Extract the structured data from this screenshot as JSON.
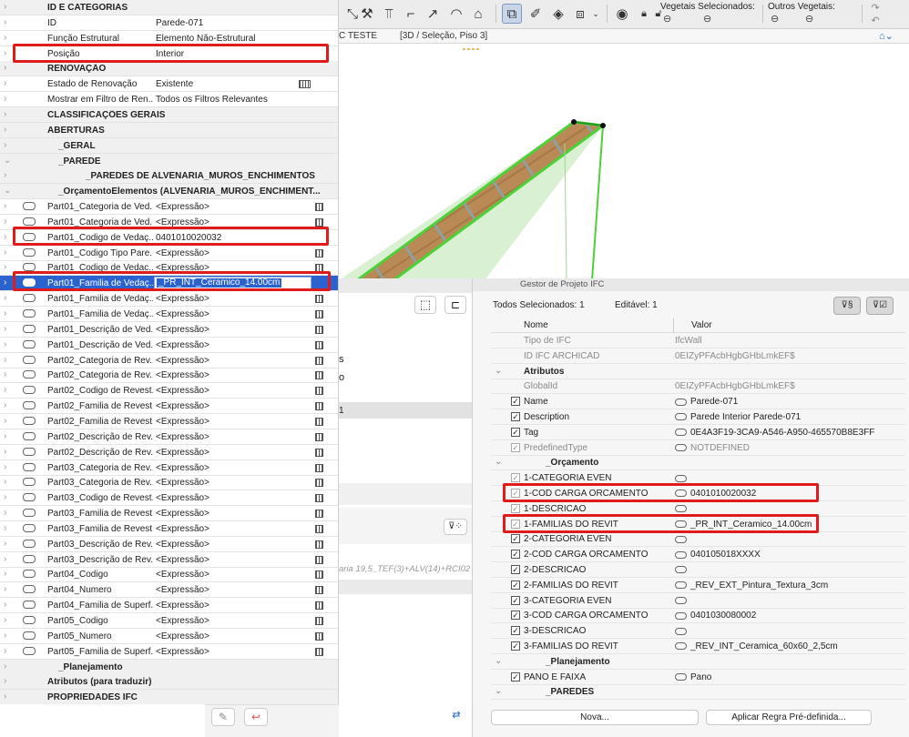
{
  "toolbar": {
    "vegetais_label": "Vegetais Selecionados:",
    "outros_label": "Outros Vegetais:"
  },
  "tabs": {
    "tab1": "C TESTE",
    "tab2": "[3D / Seleção, Piso 3]"
  },
  "left_panel": {
    "rows": [
      {
        "type": "header",
        "label": "ID E CATEGORIAS"
      },
      {
        "type": "prop",
        "label": "ID",
        "value": "Parede-071"
      },
      {
        "type": "prop",
        "label": "Função Estrutural",
        "value": "Elemento Não-Estrutural"
      },
      {
        "type": "prop",
        "label": "Posição",
        "value": "Interior"
      },
      {
        "type": "header",
        "label": "RENOVAÇÃO"
      },
      {
        "type": "prop",
        "label": "Estado de Renovação",
        "value": "Existente",
        "icon": "grid-icon"
      },
      {
        "type": "prop",
        "label": "Mostrar em Filtro de Ren...",
        "value": "Todos os Filtros Relevantes"
      },
      {
        "type": "header",
        "chev": "›",
        "label": "CLASSIFICAÇÕES GERAIS"
      },
      {
        "type": "header",
        "chev": "›",
        "label": "ABERTURAS"
      },
      {
        "type": "header",
        "chev": "›",
        "label": "_GERAL",
        "indent": 1
      },
      {
        "type": "header",
        "chev": "⌄",
        "label": "_PAREDE",
        "indent": 1
      },
      {
        "type": "header",
        "chev": "›",
        "label": "_PAREDES DE ALVENARIA_MUROS_ENCHIMENTOS",
        "indent": 2
      },
      {
        "type": "header",
        "chev": "⌄",
        "label": "_OrçamentoElementos (ALVENARIA_MUROS_ENCHIMENT...",
        "indent": 1
      },
      {
        "type": "exp",
        "label": "Part01_Categoria de Ved...",
        "value": "<Expressão>"
      },
      {
        "type": "exp",
        "label": "Part01_Categoria de Ved...",
        "value": "<Expressão>"
      },
      {
        "type": "exp",
        "label": "Part01_Codigo de Vedaç...",
        "value": "0401010020032",
        "nocalc": true
      },
      {
        "type": "exp",
        "label": "Part01_Codigo Tipo Pare...",
        "value": "<Expressão>"
      },
      {
        "type": "exp",
        "label": "Part01_Codigo de Vedac...",
        "value": "<Expressão>"
      },
      {
        "type": "selected",
        "label": "Part01_Familia de Vedaç...",
        "value": "_PR_INT_Ceramico_14.00cm"
      },
      {
        "type": "exp",
        "label": "Part01_Familia de Vedaç...",
        "value": "<Expressão>"
      },
      {
        "type": "exp",
        "label": "Part01_Familia de Vedaç...",
        "value": "<Expressão>"
      },
      {
        "type": "exp",
        "label": "Part01_Descrição de Ved...",
        "value": "<Expressão>"
      },
      {
        "type": "exp",
        "label": "Part01_Descrição de Ved...",
        "value": "<Expressão>"
      },
      {
        "type": "exp",
        "label": "Part02_Categoria de Rev...",
        "value": "<Expressão>"
      },
      {
        "type": "exp",
        "label": "Part02_Categoria de Rev...",
        "value": "<Expressão>"
      },
      {
        "type": "exp",
        "label": "Part02_Codigo de Revest...",
        "value": "<Expressão>"
      },
      {
        "type": "exp",
        "label": "Part02_Familia de Revest...",
        "value": "<Expressão>"
      },
      {
        "type": "exp",
        "label": "Part02_Familia de Revest...",
        "value": "<Expressão>"
      },
      {
        "type": "exp",
        "label": "Part02_Descrição de Rev...",
        "value": "<Expressão>"
      },
      {
        "type": "exp",
        "label": "Part02_Descrição de Rev...",
        "value": "<Expressão>"
      },
      {
        "type": "exp",
        "label": "Part03_Categoria de Rev...",
        "value": "<Expressão>"
      },
      {
        "type": "exp",
        "label": "Part03_Categoria de Rev...",
        "value": "<Expressão>"
      },
      {
        "type": "exp",
        "label": "Part03_Codigo de Revest...",
        "value": "<Expressão>"
      },
      {
        "type": "exp",
        "label": "Part03_Familia de Revest...",
        "value": "<Expressão>"
      },
      {
        "type": "exp",
        "label": "Part03_Familia de Revest...",
        "value": "<Expressão>"
      },
      {
        "type": "exp",
        "label": "Part03_Descrição de Rev...",
        "value": "<Expressão>"
      },
      {
        "type": "exp",
        "label": "Part03_Descrição de Rev...",
        "value": "<Expressão>"
      },
      {
        "type": "exp",
        "label": "Part04_Codigo",
        "value": "<Expressão>"
      },
      {
        "type": "exp",
        "label": "Part04_Numero",
        "value": "<Expressão>"
      },
      {
        "type": "exp",
        "label": "Part04_Familia de Superf...",
        "value": "<Expressão>"
      },
      {
        "type": "exp",
        "label": "Part05_Codigo",
        "value": "<Expressão>"
      },
      {
        "type": "exp",
        "label": "Part05_Numero",
        "value": "<Expressão>"
      },
      {
        "type": "exp",
        "label": "Part05_Familia de Superf...",
        "value": "<Expressão>"
      },
      {
        "type": "header",
        "chev": "›",
        "label": "_Planejamento",
        "indent": 1
      },
      {
        "type": "header",
        "chev": "›",
        "label": "Atributos (para traduzir)"
      },
      {
        "type": "header",
        "chev": "›",
        "label": "PROPRIEDADES IFC"
      }
    ]
  },
  "mid_panel": {
    "fragments": [
      "s",
      "o",
      "1",
      "aria 19,5_TEF(3)+ALV(14)+RCI02"
    ]
  },
  "ifc": {
    "title": "Gestor de Projeto IFC",
    "all_selected": "Todos Selecionados: 1",
    "editable": "Editável: 1",
    "col_name": "Nome",
    "col_value": "Valor",
    "rows": [
      {
        "kind": "plain",
        "name": "Tipo de IFC",
        "value": "IfcWall",
        "gray": true
      },
      {
        "kind": "plain",
        "name": "ID IFC ARCHICAD",
        "value": "0EIZyPFAcbHgbGHbLmkEF$",
        "gray": true
      },
      {
        "kind": "group",
        "name": "Atributos"
      },
      {
        "kind": "plain",
        "name": "GlobalId",
        "value": "0EIZyPFAcbHgbGHbLmkEF$",
        "gray": true
      },
      {
        "kind": "check",
        "name": "Name",
        "value": "Parede-071",
        "link": true
      },
      {
        "kind": "check",
        "name": "Description",
        "value": "Parede Interior Parede-071",
        "link": true
      },
      {
        "kind": "check",
        "name": "Tag",
        "value": "0E4A3F19-3CA9-A546-A950-465570B8E3FF",
        "link": true
      },
      {
        "kind": "check",
        "name": "PredefinedType",
        "value": "NOTDEFINED",
        "link": true,
        "gray": true
      },
      {
        "kind": "group",
        "name": "_Orçamento",
        "indent": true
      },
      {
        "kind": "check",
        "name": "1-CATEGORIA EVEN",
        "value": "",
        "link": true,
        "dim": true
      },
      {
        "kind": "check",
        "name": "1-COD CARGA ORCAMENTO",
        "value": "0401010020032",
        "link": true,
        "dim": true
      },
      {
        "kind": "check",
        "name": "1-DESCRICAO",
        "value": "",
        "link": true,
        "dim": true
      },
      {
        "kind": "check",
        "name": "1-FAMILIAS DO REVIT",
        "value": "_PR_INT_Ceramico_14.00cm",
        "link": true,
        "dim": true
      },
      {
        "kind": "check",
        "name": "2-CATEGORIA EVEN",
        "value": "",
        "link": true
      },
      {
        "kind": "check",
        "name": "2-COD CARGA ORCAMENTO",
        "value": "040105018XXXX",
        "link": true
      },
      {
        "kind": "check",
        "name": "2-DESCRICAO",
        "value": "",
        "link": true
      },
      {
        "kind": "check",
        "name": "2-FAMILIAS DO REVIT",
        "value": "_REV_EXT_Pintura_Textura_3cm",
        "link": true
      },
      {
        "kind": "check",
        "name": "3-CATEGORIA EVEN",
        "value": "",
        "link": true
      },
      {
        "kind": "check",
        "name": "3-COD CARGA ORCAMENTO",
        "value": "0401030080002",
        "link": true
      },
      {
        "kind": "check",
        "name": "3-DESCRICAO",
        "value": "",
        "link": true
      },
      {
        "kind": "check",
        "name": "3-FAMILIAS DO REVIT",
        "value": "_REV_INT_Ceramica_60x60_2,5cm",
        "link": true
      },
      {
        "kind": "group",
        "name": "_Planejamento",
        "indent": true
      },
      {
        "kind": "check",
        "name": "PANO E FAIXA",
        "value": "Pano",
        "link": true
      },
      {
        "kind": "group",
        "name": "_PAREDES",
        "indent": true
      }
    ],
    "btn_new": "Nova...",
    "btn_rule": "Aplicar Regra Pré-definida..."
  },
  "colors": {
    "selection": "#2a62cf",
    "highlight_box": "#e01b1b",
    "wall_green": "#4fcf3a",
    "wall_wood": "#b98a55"
  }
}
